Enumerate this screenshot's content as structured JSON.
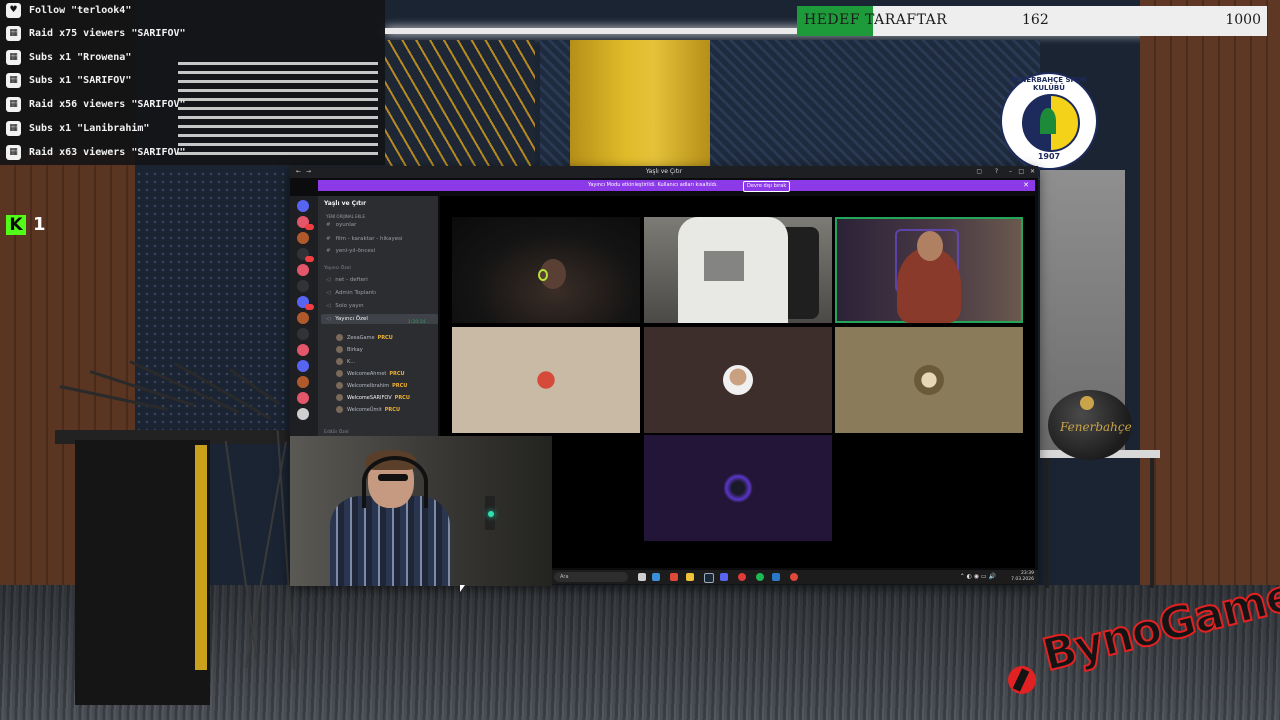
{
  "alerts": [
    {
      "icon": "heart-icon",
      "text": "Follow \"terlook4\""
    },
    {
      "icon": "raid-icon",
      "text": "Raid x75 viewers \"SARIFOV\""
    },
    {
      "icon": "subs-icon",
      "text": "Subs x1 \"Rrowena\""
    },
    {
      "icon": "subs-icon",
      "text": "Subs x1 \"SARIFOV\""
    },
    {
      "icon": "raid-icon",
      "text": "Raid x56 viewers \"SARIFOV\""
    },
    {
      "icon": "subs-icon",
      "text": "Subs x1 \"Lanibrahim\""
    },
    {
      "icon": "raid-icon",
      "text": "Raid x63 viewers \"SARIFOV\""
    }
  ],
  "kick": {
    "logo": "K",
    "viewer_count": "1",
    "color": "#53fc18"
  },
  "goal": {
    "label": "HEDEF TARAFTAR",
    "current": "162",
    "target": "1000",
    "progress_fraction": 0.162,
    "fill_color": "#1d9a3a"
  },
  "club_badge": {
    "top_text": "FENERBAHÇE SPOR KULÜBÜ",
    "year": "1907"
  },
  "ball_text": "Fenerbahçe",
  "brand_logo": "BynoGame",
  "window": {
    "title": "Yaşlı ve Çıtır",
    "banner_text": "Yayıncı Modu etkinleştirildi. Kullanıcı adları kısaltıldı.",
    "banner_button": "Devre dışı bırak",
    "guild_name": "Yaşlı ve Çıtır",
    "channels_top": [
      {
        "name": "YENİ ORIJINAL EKLE",
        "type": "tooltip"
      },
      {
        "name": "oyunlar",
        "type": "text"
      },
      {
        "name": "film - karaktar - hikayesi",
        "type": "text"
      },
      {
        "name": "yeni-yıl-öncesi",
        "type": "text"
      }
    ],
    "category_voice": "Yayıncı Özel",
    "voice_channels": [
      {
        "name": "net - defteri"
      },
      {
        "name": "Admin Toplantı"
      },
      {
        "name": "Solo yayın"
      },
      {
        "name": "Yayıncı Özel",
        "active": true
      }
    ],
    "channel_timer": "1:20:14",
    "voice_users": [
      {
        "name": "ZeeaGame",
        "tag": "PRCU"
      },
      {
        "name": "Birkay",
        "tag": ""
      },
      {
        "name": "K...",
        "tag": ""
      },
      {
        "name": "WelcomeAhmet",
        "tag": "PRCU"
      },
      {
        "name": "WelcomeIbrahim",
        "tag": "PRCU"
      },
      {
        "name": "WelcomeSARIFOV",
        "tag": "PRCU"
      },
      {
        "name": "WelcomeÜmit",
        "tag": "PRCU"
      }
    ],
    "category_editor": "Editör Özel",
    "taskbar": {
      "search_placeholder": "Ara",
      "time": "23:39",
      "date": "7.03.2026"
    }
  }
}
